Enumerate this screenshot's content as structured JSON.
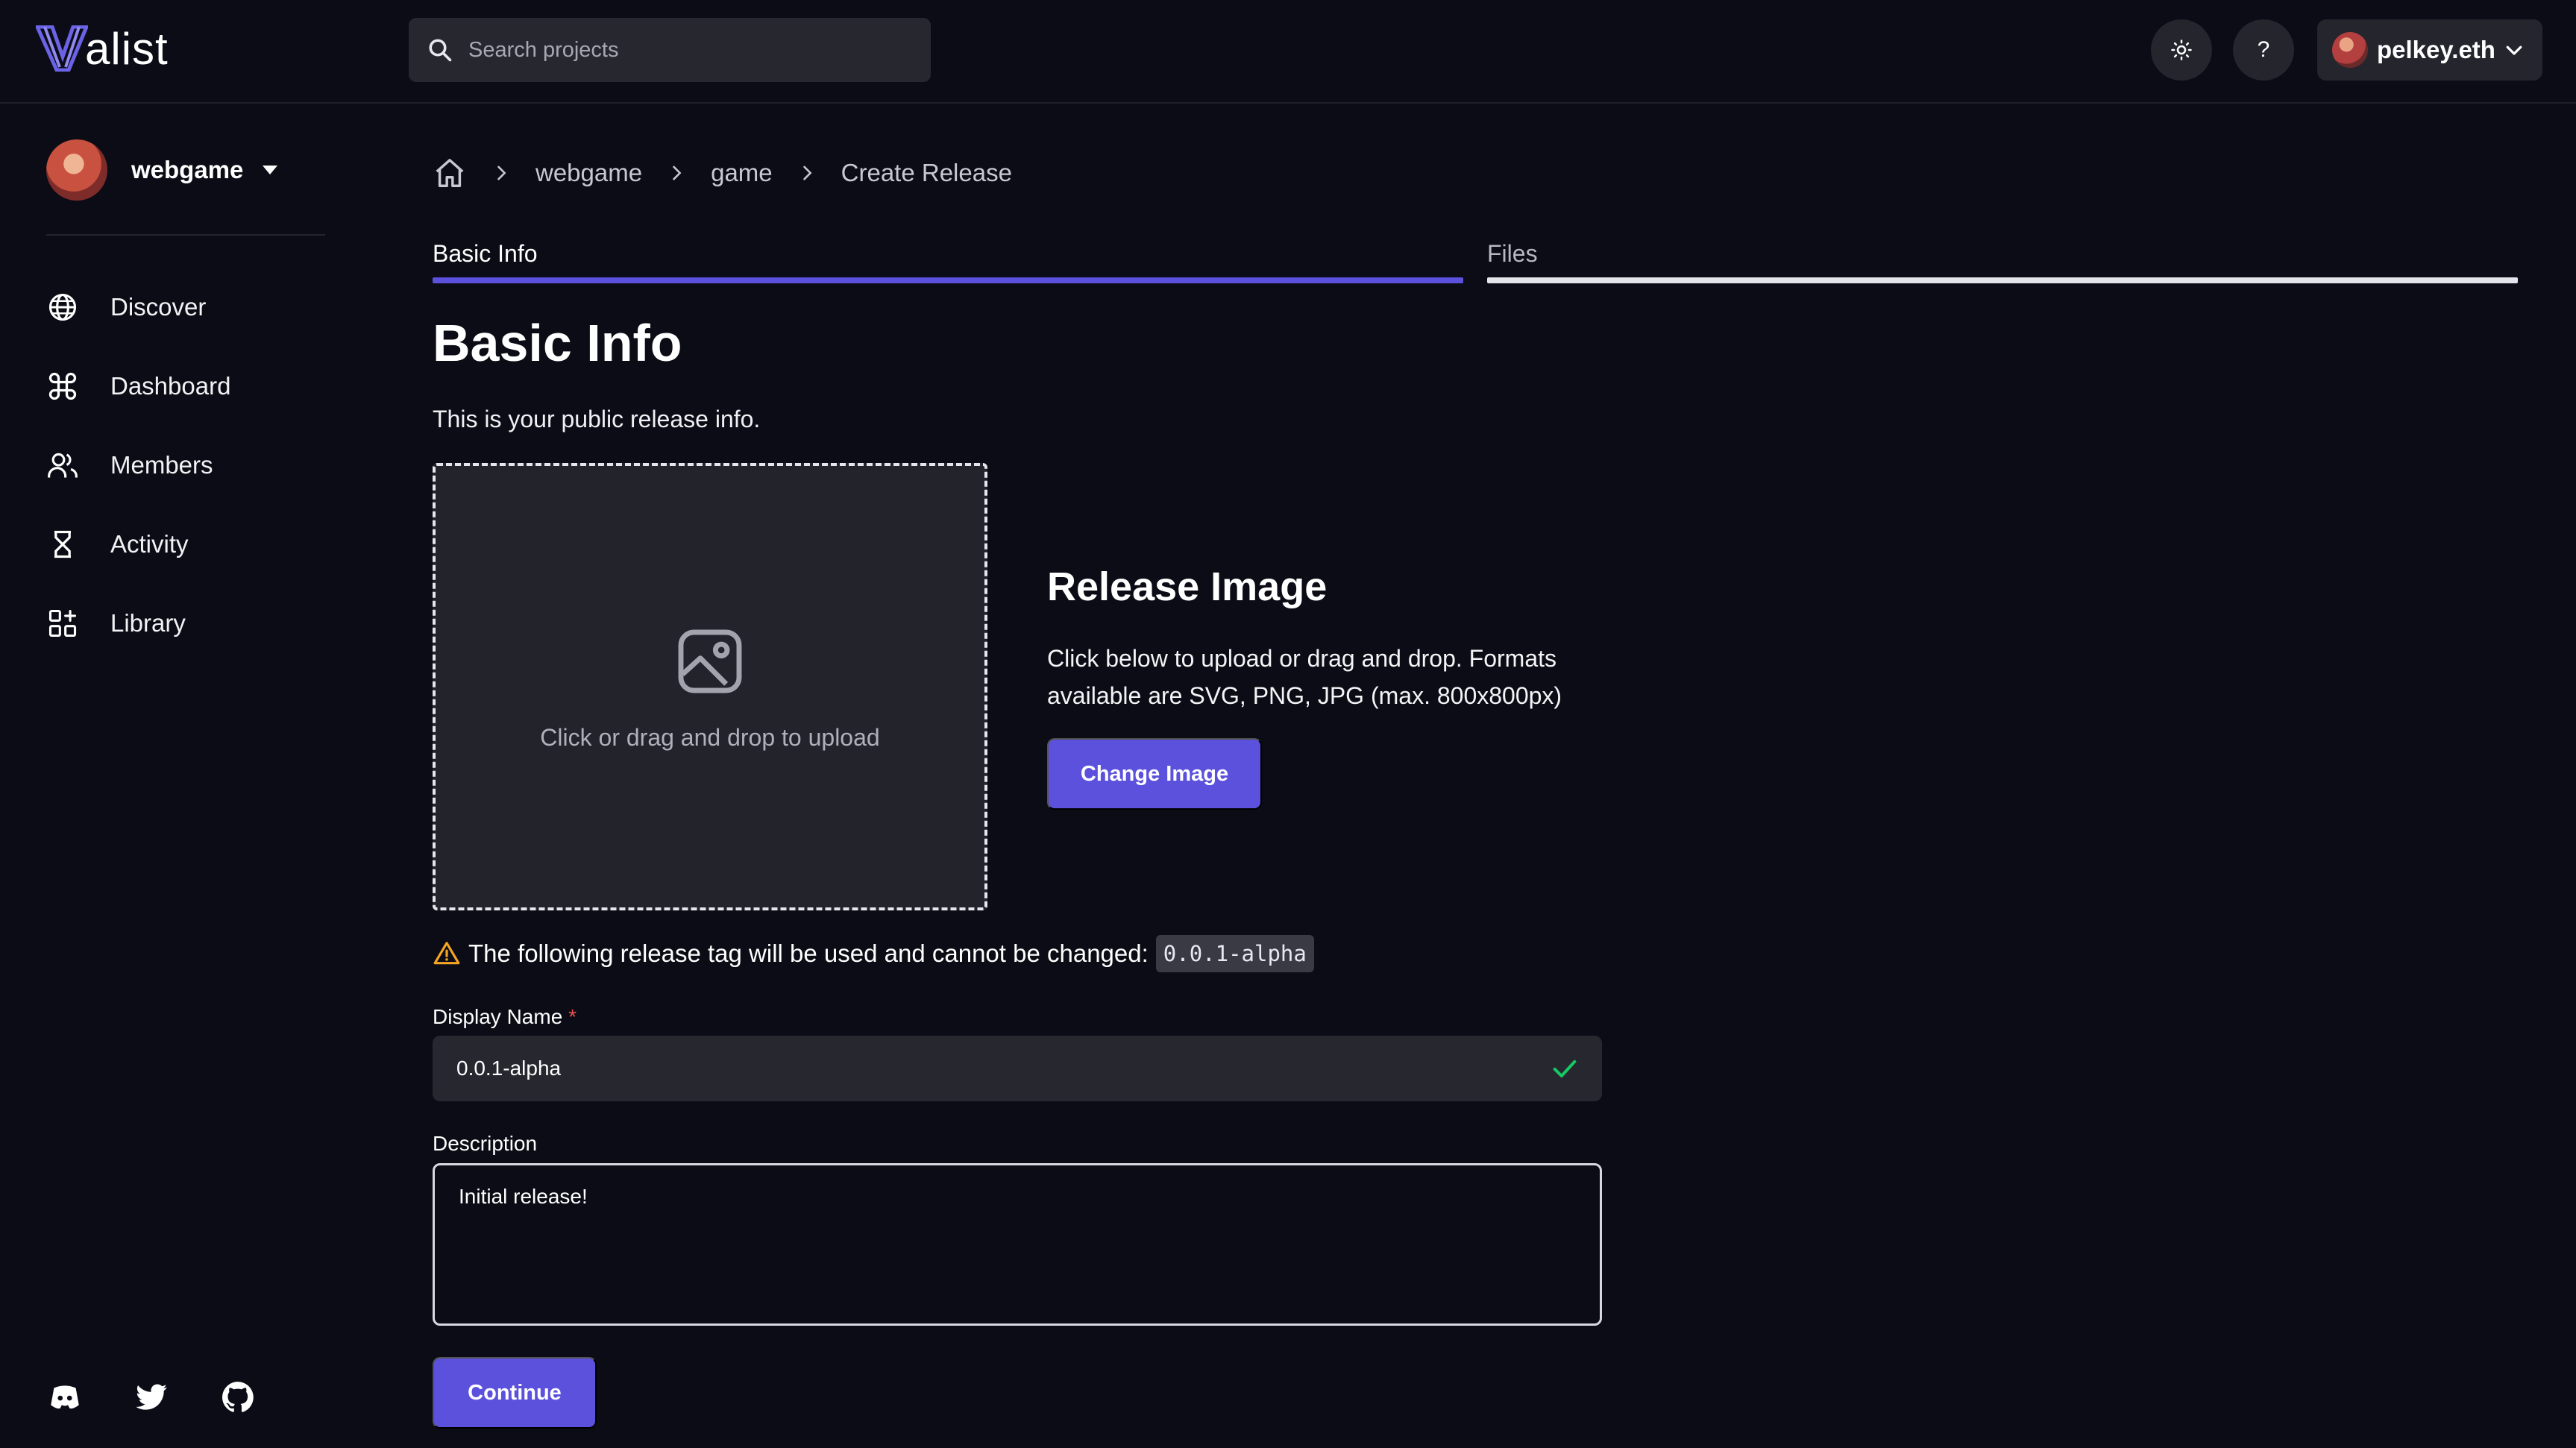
{
  "app": {
    "logo_text": "alist"
  },
  "search": {
    "placeholder": "Search projects"
  },
  "header": {
    "help_label": "?",
    "account_label": "pelkey.eth"
  },
  "sidebar": {
    "project_name": "webgame",
    "items": [
      {
        "label": "Discover",
        "icon": "globe-icon"
      },
      {
        "label": "Dashboard",
        "icon": "command-icon"
      },
      {
        "label": "Members",
        "icon": "users-icon"
      },
      {
        "label": "Activity",
        "icon": "hourglass-icon"
      },
      {
        "label": "Library",
        "icon": "apps-add-icon"
      }
    ],
    "socials": [
      "discord-icon",
      "twitter-icon",
      "github-icon"
    ]
  },
  "breadcrumb": {
    "items": [
      "webgame",
      "game",
      "Create Release"
    ]
  },
  "tabs": {
    "basic": "Basic Info",
    "files": "Files"
  },
  "main": {
    "title": "Basic Info",
    "subtitle": "This is your public release info.",
    "dropzone_label": "Click or drag and drop to upload",
    "release_image_title": "Release Image",
    "release_image_desc": "Click below to upload or drag and drop. Formats available are SVG, PNG, JPG (max. 800x800px)",
    "change_image_label": "Change Image",
    "warning_text": "The following release tag will be used and cannot be changed:",
    "release_tag": "0.0.1-alpha",
    "display_name_label": "Display Name",
    "required_marker": "*",
    "display_name_value": "0.0.1-alpha",
    "description_label": "Description",
    "description_value": "Initial release!",
    "continue_label": "Continue"
  },
  "colors": {
    "background": "#0c0c16",
    "accent": "#5b51dd",
    "input_bg": "#272730",
    "warning": "#f5a524",
    "success": "#17c964"
  }
}
